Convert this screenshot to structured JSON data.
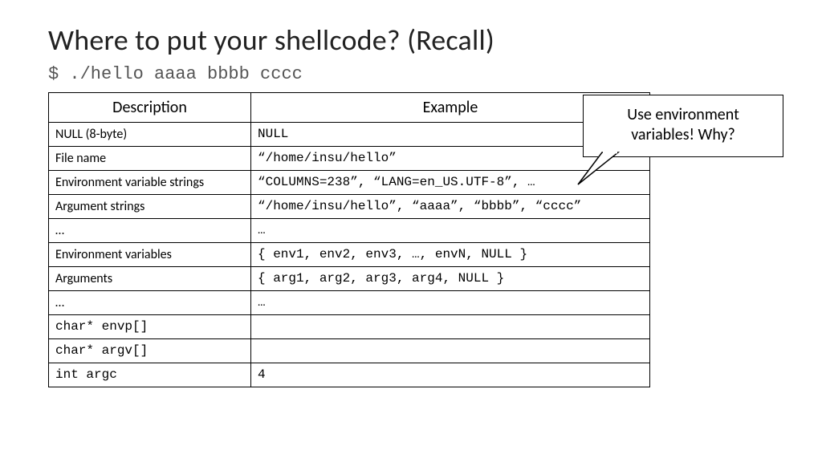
{
  "title": "Where to put your shellcode? (Recall)",
  "command": "$ ./hello aaaa bbbb cccc",
  "table": {
    "headers": {
      "desc": "Description",
      "example": "Example"
    },
    "rows": [
      {
        "desc": "NULL (8-byte)",
        "desc_mono": false,
        "example": "NULL"
      },
      {
        "desc": "File name",
        "desc_mono": false,
        "example": "“/home/insu/hello”"
      },
      {
        "desc": "Environment variable strings",
        "desc_mono": false,
        "example": "“COLUMNS=238”, “LANG=en_US.UTF-8”, …"
      },
      {
        "desc": "Argument strings",
        "desc_mono": false,
        "example": "“/home/insu/hello”, “aaaa”, “bbbb”, “cccc”"
      },
      {
        "desc": "…",
        "desc_mono": false,
        "example": "…"
      },
      {
        "desc": "Environment variables",
        "desc_mono": false,
        "example": "{ env1, env2, env3, …, envN, NULL }"
      },
      {
        "desc": "Arguments",
        "desc_mono": false,
        "example": "{ arg1, arg2, arg3, arg4, NULL }"
      },
      {
        "desc": "…",
        "desc_mono": false,
        "example": "…"
      },
      {
        "desc": "char* envp[]",
        "desc_mono": true,
        "example": ""
      },
      {
        "desc": "char* argv[]",
        "desc_mono": true,
        "example": ""
      },
      {
        "desc": "int argc",
        "desc_mono": true,
        "example": "4"
      }
    ]
  },
  "callout": {
    "line1": "Use environment",
    "line2": "variables! Why?"
  }
}
